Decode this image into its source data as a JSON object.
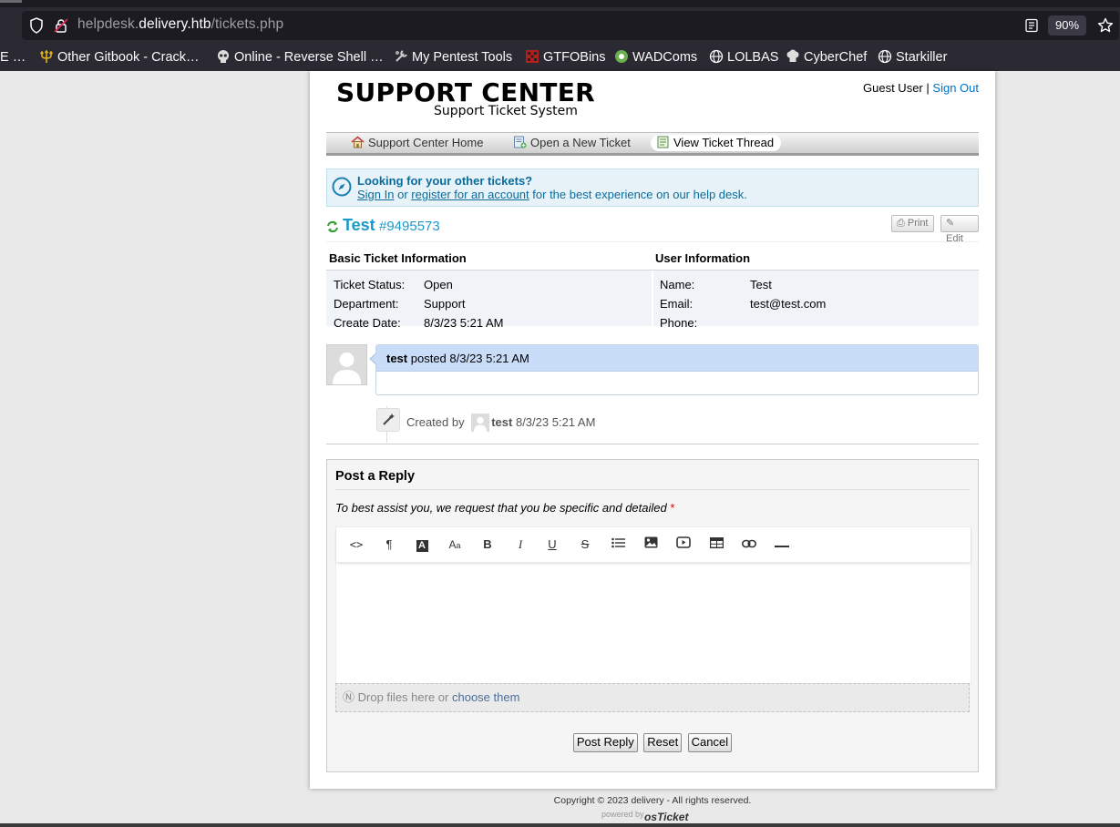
{
  "browser": {
    "url_prefix": "helpdesk.",
    "url_host": "delivery.htb",
    "url_path": "/tickets.php",
    "zoom": "90%",
    "bookmarks": [
      "E …",
      "Other Gitbook - Crack…",
      "Online - Reverse Shell …",
      "My Pentest Tools",
      "GTFOBins",
      "WADComs",
      "LOLBAS",
      "CyberChef",
      "Starkiller"
    ]
  },
  "site": {
    "logo_title": "SUPPORT CENTER",
    "logo_subtitle": "Support Ticket System",
    "guest_user": "Guest User",
    "separator": "|",
    "sign_out": "Sign Out"
  },
  "nav": {
    "items": [
      "Support Center Home",
      "Open a New Ticket",
      "View Ticket Thread"
    ],
    "active": "View Ticket Thread"
  },
  "notice": {
    "title": "Looking for your other tickets?",
    "sign_in": "Sign In",
    "or": "or",
    "register": "register for an account",
    "rest": "for the best experience on our help desk."
  },
  "ticket": {
    "subject": "Test",
    "number": "#9495573",
    "print": "Print",
    "edit": "Edit",
    "basic_header": "Basic Ticket Information",
    "user_header": "User Information",
    "basic": [
      {
        "label": "Ticket Status:",
        "value": "Open"
      },
      {
        "label": "Department:",
        "value": "Support"
      },
      {
        "label": "Create Date:",
        "value": "8/3/23 5:21 AM"
      }
    ],
    "user": [
      {
        "label": "Name:",
        "value": "Test"
      },
      {
        "label": "Email:",
        "value": "test@test.com"
      },
      {
        "label": "Phone:",
        "value": ""
      }
    ]
  },
  "thread": {
    "author": "test",
    "posted": "posted 8/3/23 5:21 AM",
    "event_created_by": "Created by",
    "event_user": "test",
    "event_time": "8/3/23 5:21 AM"
  },
  "reply": {
    "heading": "Post a Reply",
    "hint": "To best assist you, we request that you be specific and detailed",
    "required_mark": "*",
    "toolbar": [
      "code-view",
      "paragraph",
      "text-color",
      "font-size",
      "bold",
      "italic",
      "underline",
      "strikethrough",
      "list",
      "image",
      "video",
      "table",
      "link",
      "horizontal-rule"
    ],
    "drop_text": "Drop files here or",
    "choose": "choose them",
    "post_btn": "Post Reply",
    "reset_btn": "Reset",
    "cancel_btn": "Cancel"
  },
  "footer": {
    "copyright": "Copyright © 2023 delivery - All rights reserved.",
    "powered_by": "powered by",
    "brand": "osTicket"
  },
  "colors": {
    "link": "#0072c6",
    "accent": "#1b9ac9",
    "thread_header": "#c9ddf9",
    "notice_bg": "#e7f3f9"
  }
}
